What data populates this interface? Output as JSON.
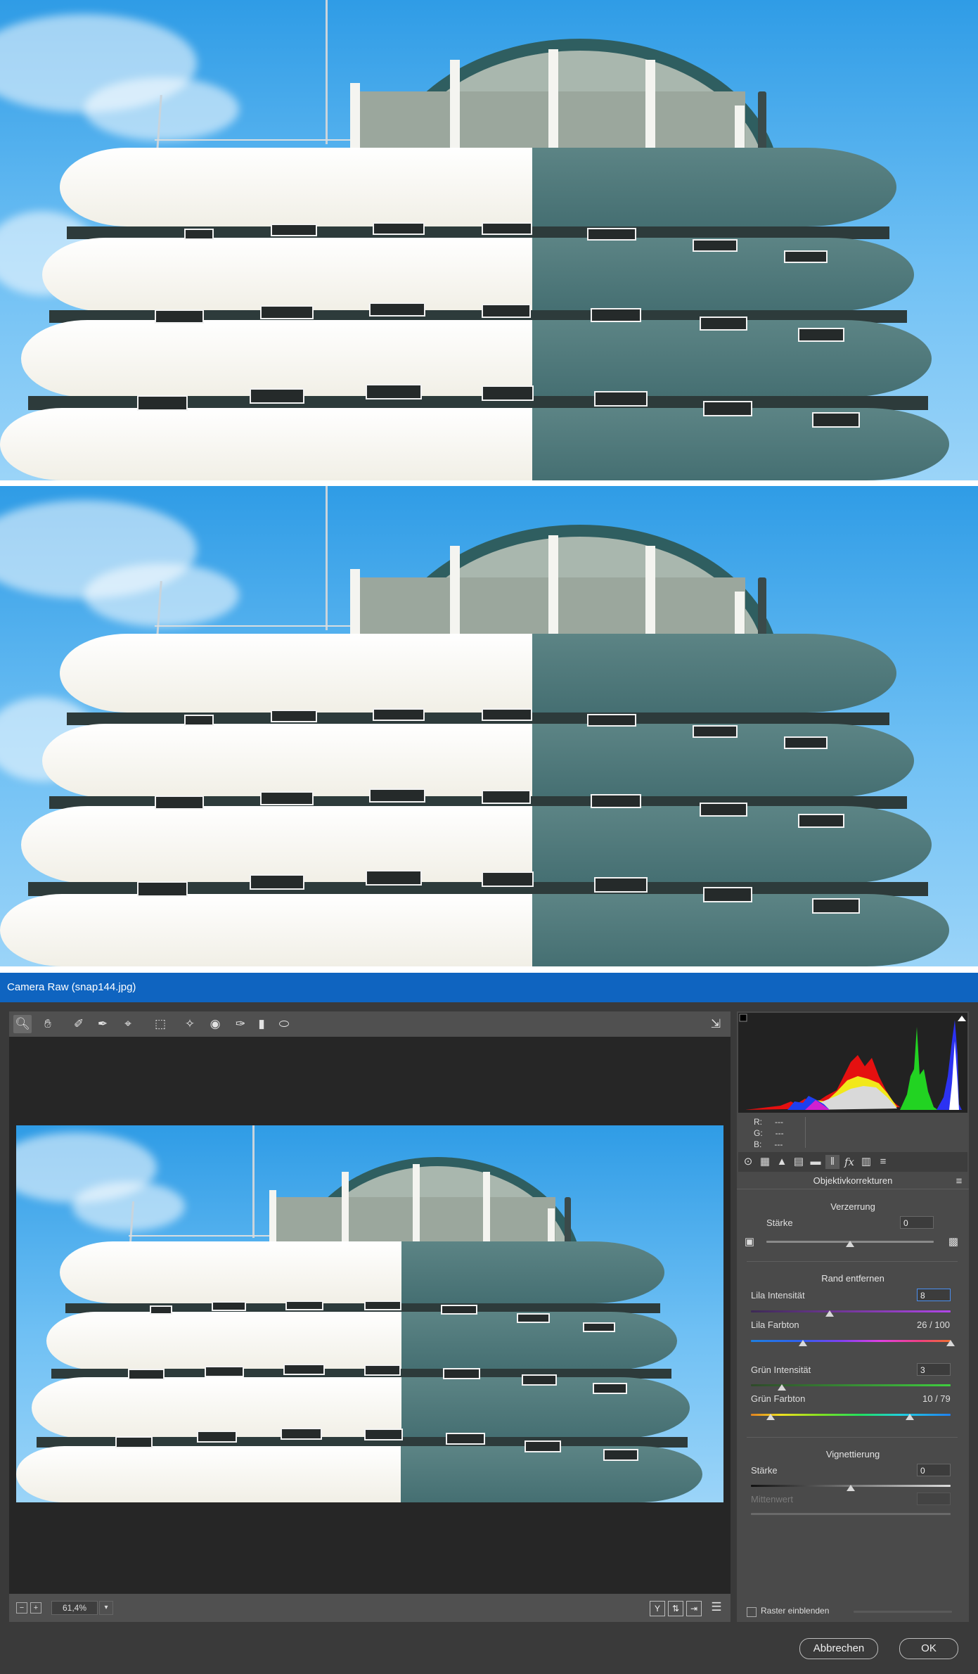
{
  "window": {
    "title": "Camera Raw (snap144.jpg)"
  },
  "toolbar": {
    "tools": [
      "zoom-icon",
      "hand-icon",
      "white-balance-icon",
      "color-sampler-icon",
      "targeted-adjustment-icon",
      "transform-icon",
      "spot-removal-icon",
      "red-eye-icon",
      "adjustment-brush-icon",
      "graduated-filter-icon",
      "radial-filter-icon"
    ],
    "open_preferences_icon": "preferences-icon"
  },
  "status": {
    "zoom_value": "61,4%"
  },
  "readout": {
    "r_label": "R:",
    "r_value": "---",
    "g_label": "G:",
    "g_value": "---",
    "b_label": "B:",
    "b_value": "---"
  },
  "panel": {
    "title": "Objektivkorrekturen",
    "distortion": {
      "heading": "Verzerrung",
      "amount_label": "Stärke",
      "amount_value": "0"
    },
    "defringe": {
      "heading": "Rand entfernen",
      "purple_amount_label": "Lila Intensität",
      "purple_amount_value": "8",
      "purple_hue_label": "Lila Farbton",
      "purple_hue_value": "26 / 100",
      "green_amount_label": "Grün Intensität",
      "green_amount_value": "3",
      "green_hue_label": "Grün Farbton",
      "green_hue_value": "10 / 79"
    },
    "vignetting": {
      "heading": "Vignettierung",
      "amount_label": "Stärke",
      "amount_value": "0",
      "midpoint_label": "Mittenwert"
    },
    "grid_label": "Raster einblenden"
  },
  "buttons": {
    "cancel": "Abbrechen",
    "ok": "OK"
  },
  "colors": {
    "title_bar": "#0f64c0",
    "sky": "#6fc0f4",
    "facade_white": "#f5f4ec",
    "facade_green": "#4f7a7c"
  }
}
